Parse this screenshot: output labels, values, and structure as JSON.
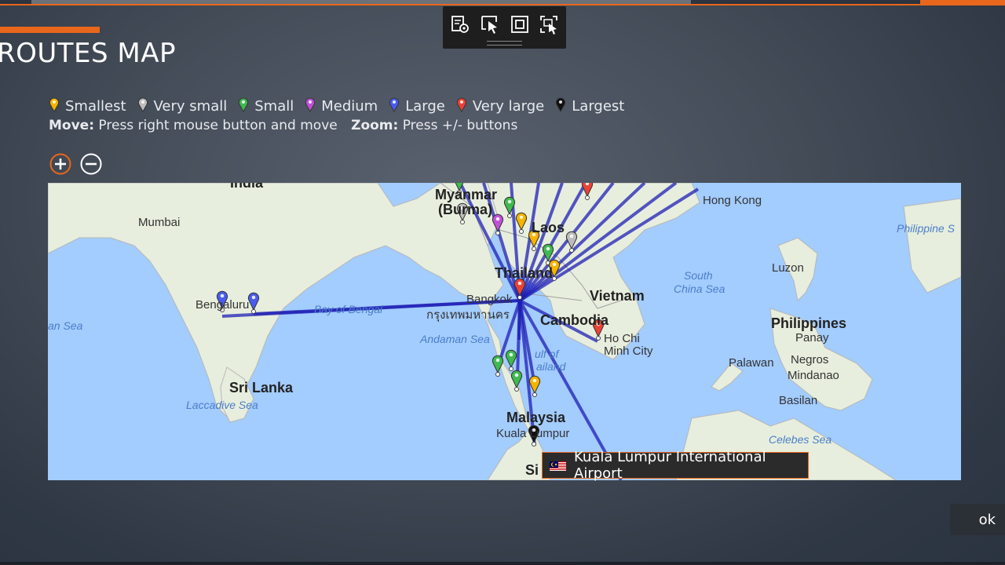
{
  "page": {
    "title": "ROUTES MAP"
  },
  "legend": [
    {
      "label": "Smallest",
      "color": "#f4b400"
    },
    {
      "label": "Very small",
      "color": "#bdbdbd"
    },
    {
      "label": "Small",
      "color": "#3fb950"
    },
    {
      "label": "Medium",
      "color": "#c050d8"
    },
    {
      "label": "Large",
      "color": "#4a5cf0"
    },
    {
      "label": "Very large",
      "color": "#ea4335"
    },
    {
      "label": "Largest",
      "color": "#111111"
    }
  ],
  "help": {
    "move_label": "Move:",
    "move_text": "Press right mouse button and move",
    "zoom_label": "Zoom:",
    "zoom_text": "Press +/- buttons"
  },
  "zoom": {
    "in_icon": "plus-circle-icon",
    "out_icon": "minus-circle-icon"
  },
  "toolbar": {
    "icons": [
      "screen-settings-icon",
      "select-pointer-icon",
      "fit-frame-icon",
      "screenshot-select-icon"
    ]
  },
  "map": {
    "places": {
      "india": "India",
      "myanmar": "Myanmar",
      "burma": "(Burma)",
      "mumbai": "Mumbai",
      "laos": "Laos",
      "hong_kong": "Hong Kong",
      "philippine_sea": "Philippine S",
      "thailand": "Thailand",
      "south_china_sea_1": "South",
      "south_china_sea_2": "China Sea",
      "luzon": "Luzon",
      "vietnam": "Vietnam",
      "bengaluru": "Bengaluru",
      "bangkok": "Bangkok",
      "bangkok_thai": "กรุงเทพมหานคร",
      "bay_of_bengal": "Bay of Bengal",
      "arabian_sea": "an Sea",
      "cambodia": "Cambodia",
      "ho_chi_minh_1": "Ho Chi",
      "ho_chi_minh_2": "Minh City",
      "philippines": "Philippines",
      "panay": "Panay",
      "andaman_sea": "Andaman Sea",
      "gulf_of_thailand_1": "ulf of",
      "gulf_of_thailand_2": "ailand",
      "palawan": "Palawan",
      "negros": "Negros",
      "mindanao": "Mindanao",
      "sri_lanka": "Sri Lanka",
      "laccadive_sea": "Laccadive Sea",
      "basilan": "Basilan",
      "malaysia": "Malaysia",
      "kuala_lumpur": "Kuala Lumpur",
      "singapore": "Si",
      "celebes_sea": "Celebes Sea"
    },
    "hub": "Bangkok",
    "route_color": "#1f1fb4",
    "marker_colors": {
      "smallest": "#f4b400",
      "very_small": "#bdbdbd",
      "small": "#3fb950",
      "medium": "#c050d8",
      "large": "#4a5cf0",
      "very_large": "#ea4335",
      "largest": "#111111"
    }
  },
  "tooltip": {
    "flag": "malaysia-flag-icon",
    "text": "Kuala Lumpur International Airport"
  },
  "ok_button": {
    "label": "ok"
  }
}
